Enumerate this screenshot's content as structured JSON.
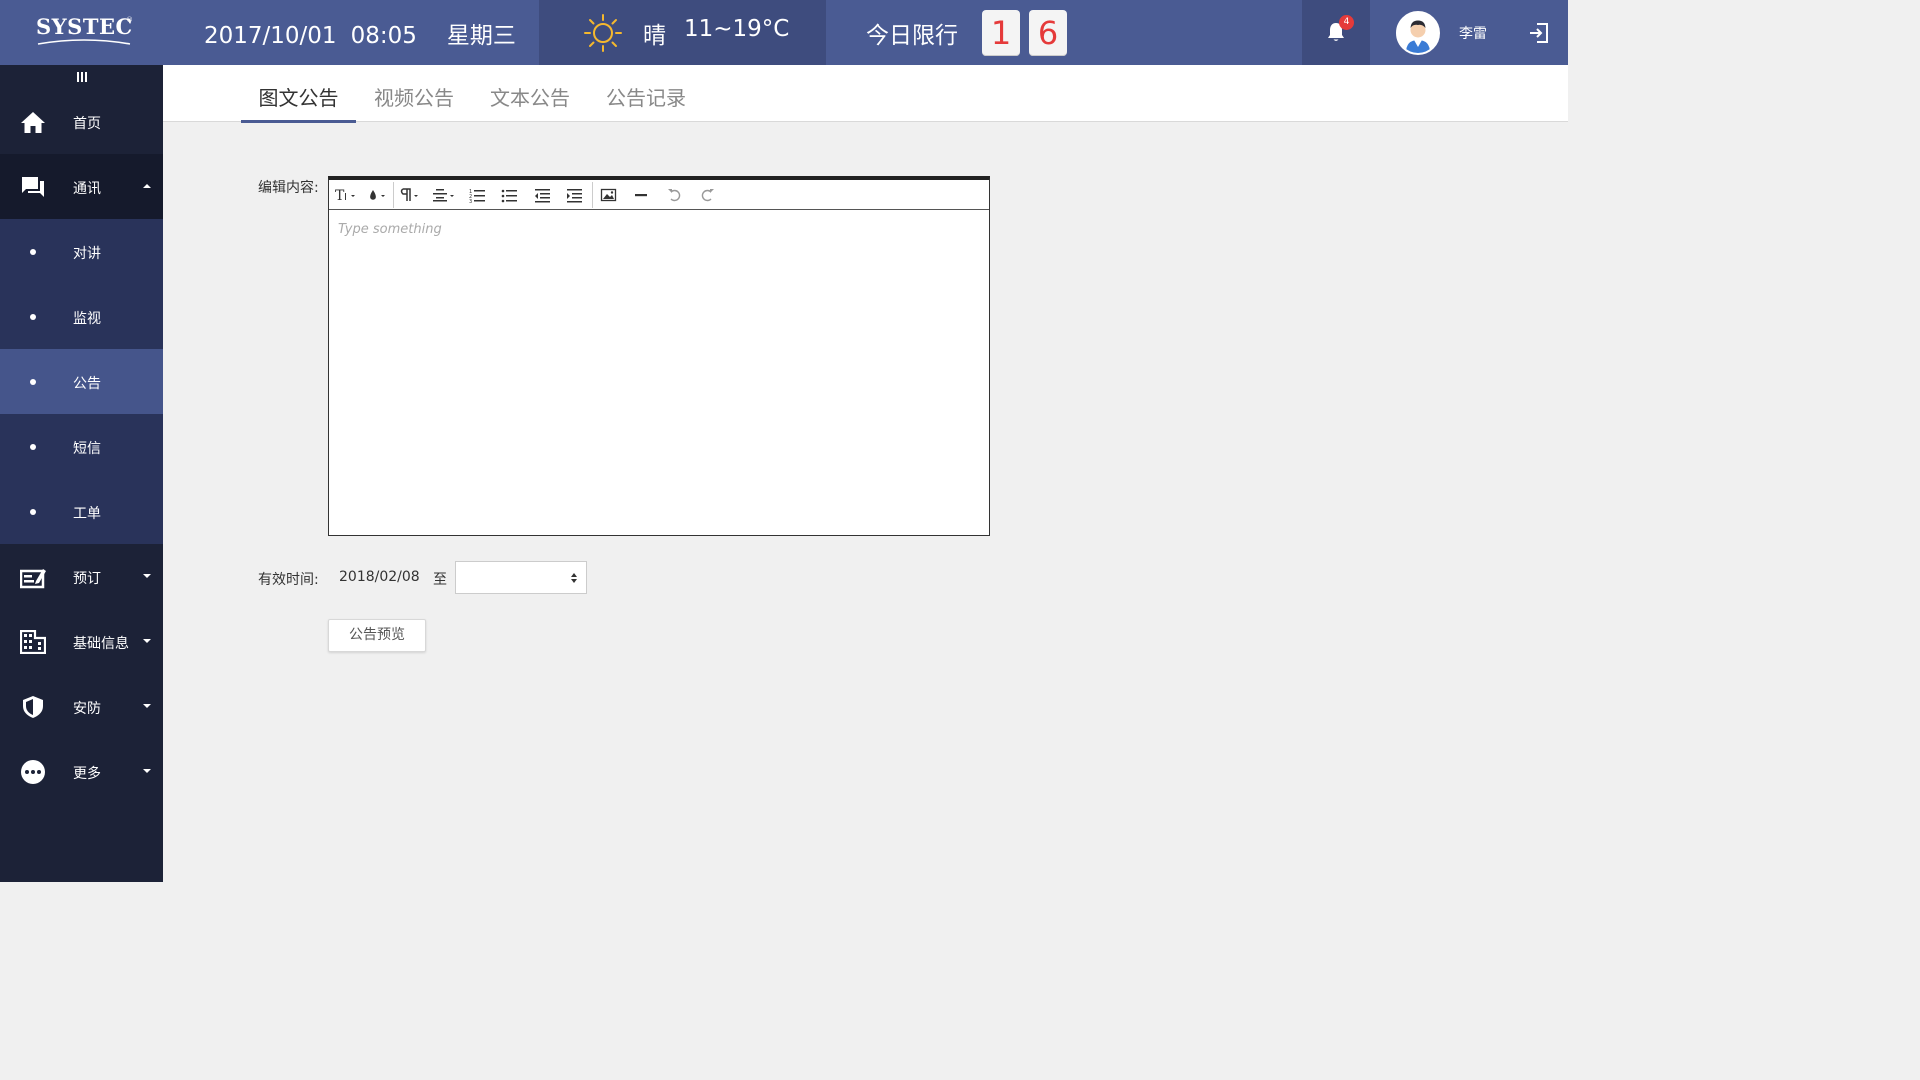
{
  "brand": {
    "name": "SYSTEC",
    "reg": "®"
  },
  "header": {
    "date": "2017/10/01",
    "time": "08:05",
    "weekday": "星期三",
    "weather_condition": "晴",
    "temperature": "11~19°C",
    "limit_label": "今日限行",
    "limit_digits": [
      "1",
      "6"
    ],
    "notification_count": "4",
    "username": "李雷"
  },
  "sidebar": {
    "items": [
      {
        "label": "首页",
        "icon": "home-icon"
      },
      {
        "label": "通讯",
        "icon": "chat-icon",
        "expanded": true
      },
      {
        "label": "预订",
        "icon": "booking-icon"
      },
      {
        "label": "基础信息",
        "icon": "building-icon"
      },
      {
        "label": "安防",
        "icon": "shield-icon"
      },
      {
        "label": "更多",
        "icon": "more-icon"
      }
    ],
    "sub_items": [
      {
        "label": "对讲"
      },
      {
        "label": "监视"
      },
      {
        "label": "公告",
        "active": true
      },
      {
        "label": "短信"
      },
      {
        "label": "工单"
      }
    ]
  },
  "tabs": [
    {
      "label": "图文公告",
      "active": true
    },
    {
      "label": "视频公告"
    },
    {
      "label": "文本公告"
    },
    {
      "label": "公告记录"
    }
  ],
  "form": {
    "edit_label": "编辑内容:",
    "editor_placeholder": "Type something",
    "toolbar_icons": [
      "font-size-icon",
      "text-color-icon",
      "paragraph-icon",
      "align-icon",
      "ordered-list-icon",
      "bullet-list-icon",
      "outdent-icon",
      "indent-icon",
      "image-icon",
      "horizontal-rule-icon",
      "undo-icon",
      "redo-icon"
    ],
    "valid_label": "有效时间:",
    "valid_start": "2018/02/08",
    "valid_to": "至",
    "valid_end": "",
    "preview_button": "公告预览"
  },
  "colors": {
    "header": "#4a5b93",
    "sidebar": "#1c2237",
    "submenu": "#29335a",
    "active": "#45558b",
    "limit_digit": "#e53a3a"
  }
}
